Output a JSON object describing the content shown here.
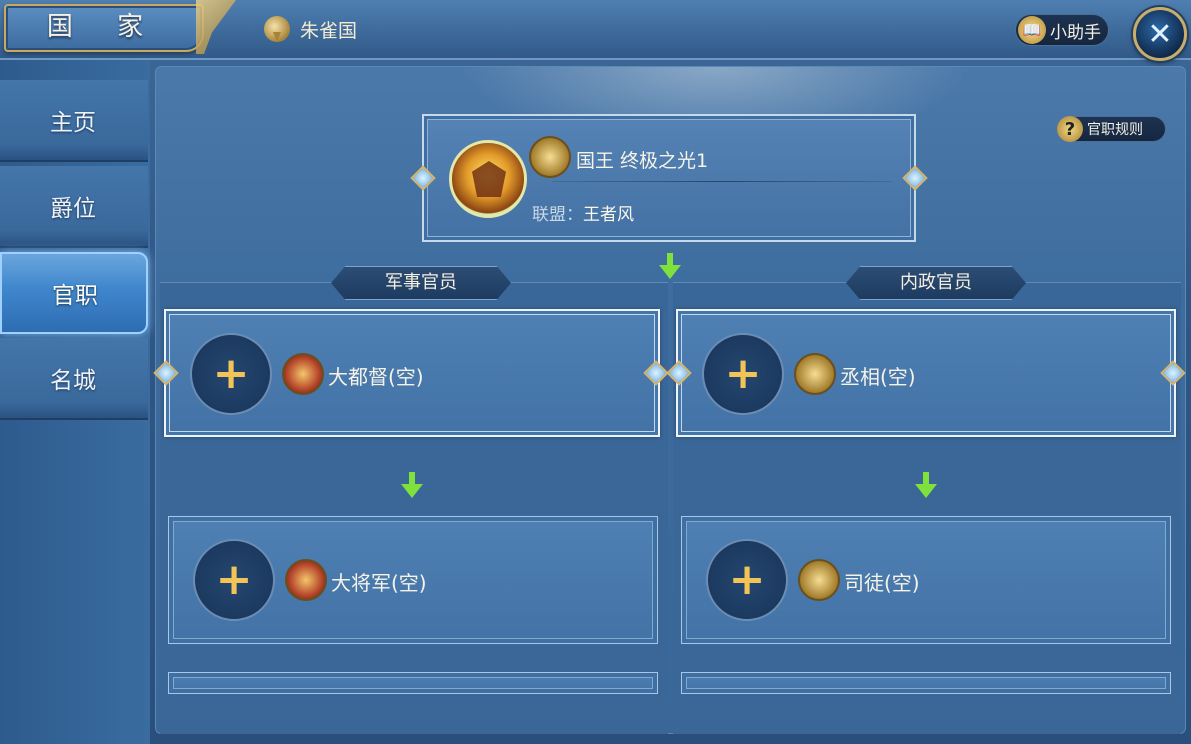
{
  "header": {
    "title": "国 家",
    "nation_name": "朱雀国",
    "helper_label": "小助手",
    "close_icon": "close-icon"
  },
  "sidebar": {
    "items": [
      {
        "label": "主页",
        "active": false
      },
      {
        "label": "爵位",
        "active": false
      },
      {
        "label": "官职",
        "active": true
      },
      {
        "label": "名城",
        "active": false
      }
    ]
  },
  "main": {
    "rules_label": "官职规则",
    "king": {
      "title": "国王  终极之光1",
      "alliance_label": "联盟：",
      "alliance_value": "王者风"
    },
    "military": {
      "header": "军事官员",
      "positions": [
        {
          "name": "大都督(空)"
        },
        {
          "name": "大将军(空)"
        }
      ]
    },
    "civil": {
      "header": "内政官员",
      "positions": [
        {
          "name": "丞相(空)"
        },
        {
          "name": "司徒(空)"
        }
      ]
    },
    "plus_symbol": "+"
  },
  "colors": {
    "accent_gold": "#c8a962",
    "arrow_green": "#7fe23c",
    "plus_gold": "#f2c457",
    "active_tab": "#3f86cc"
  }
}
